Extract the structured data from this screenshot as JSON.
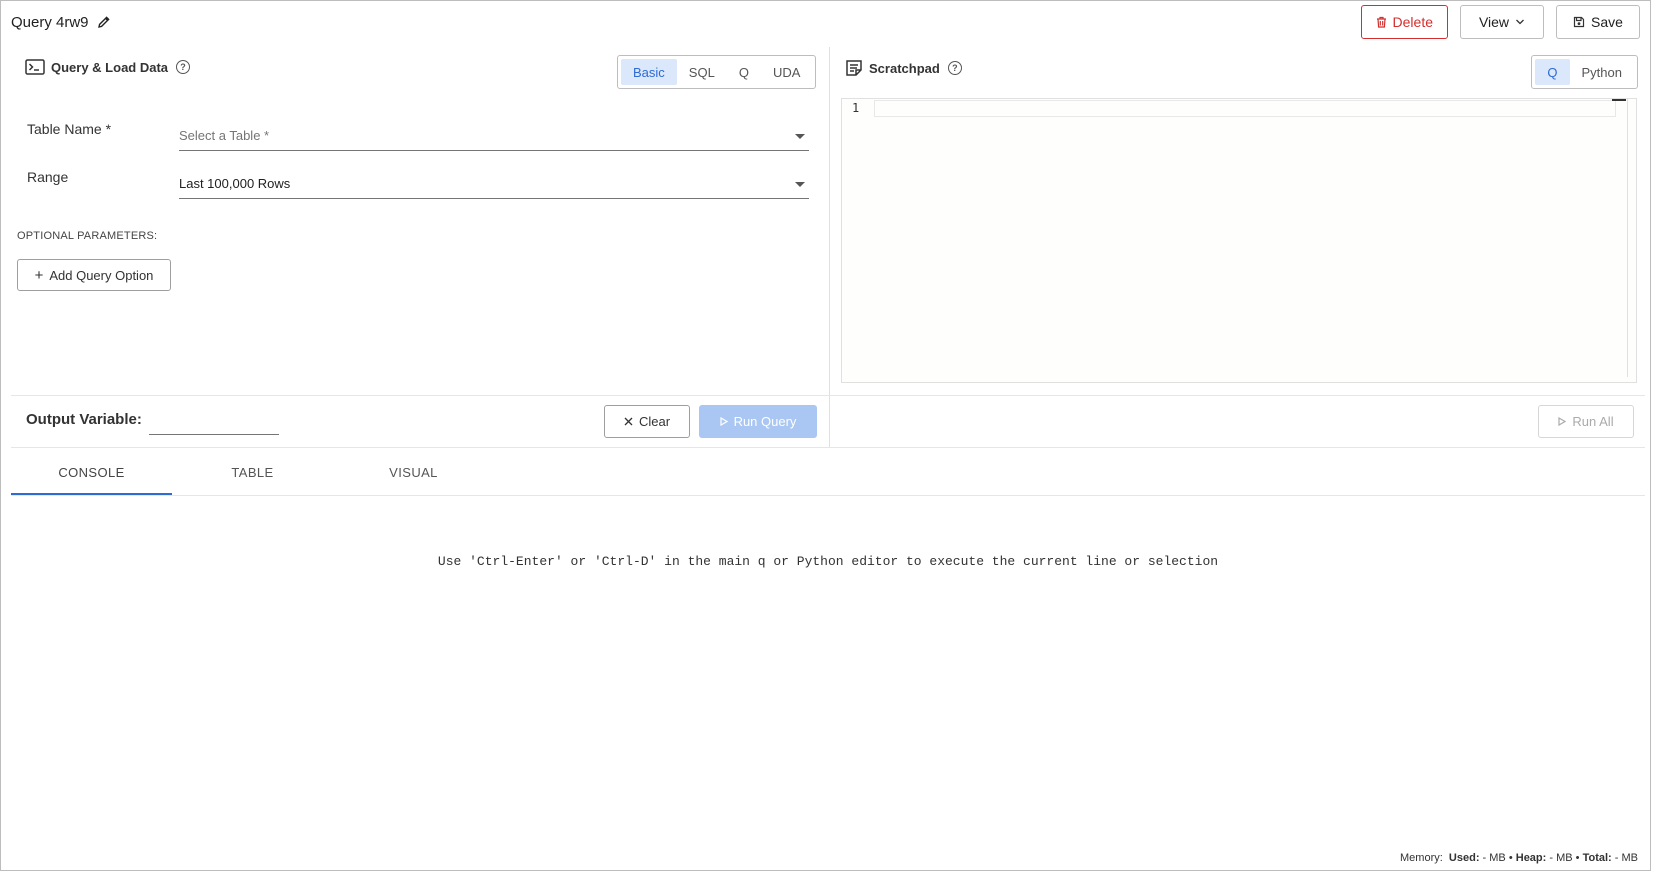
{
  "header": {
    "title": "Query 4rw9",
    "delete_label": "Delete",
    "view_label": "View",
    "save_label": "Save"
  },
  "query_panel": {
    "title": "Query & Load Data",
    "modes": [
      "Basic",
      "SQL",
      "Q",
      "UDA"
    ],
    "active_mode": "Basic",
    "table_name_label": "Table Name *",
    "table_name_placeholder": "Select a Table *",
    "range_label": "Range",
    "range_value": "Last 100,000 Rows",
    "optional_params_label": "OPTIONAL PARAMETERS:",
    "add_option_label": "Add Query Option",
    "output_variable_label": "Output Variable:",
    "output_variable_value": "",
    "clear_label": "Clear",
    "run_query_label": "Run Query"
  },
  "scratchpad": {
    "title": "Scratchpad",
    "modes": [
      "Q",
      "Python"
    ],
    "active_mode": "Q",
    "line_number": "1",
    "run_all_label": "Run All"
  },
  "tabs": [
    {
      "label": "CONSOLE",
      "active": true
    },
    {
      "label": "TABLE",
      "active": false
    },
    {
      "label": "VISUAL",
      "active": false
    }
  ],
  "console_message": "Use 'Ctrl-Enter' or 'Ctrl-D' in the main q or Python editor to execute the current line or selection",
  "memory": {
    "label": "Memory:",
    "used_label": "Used:",
    "used_value": "- MB",
    "heap_label": "Heap:",
    "heap_value": "- MB",
    "total_label": "Total:",
    "total_value": "- MB"
  },
  "colors": {
    "accent": "#2e6bd2",
    "danger": "#d32f2f",
    "run_disabled": "#a9c7f2"
  }
}
